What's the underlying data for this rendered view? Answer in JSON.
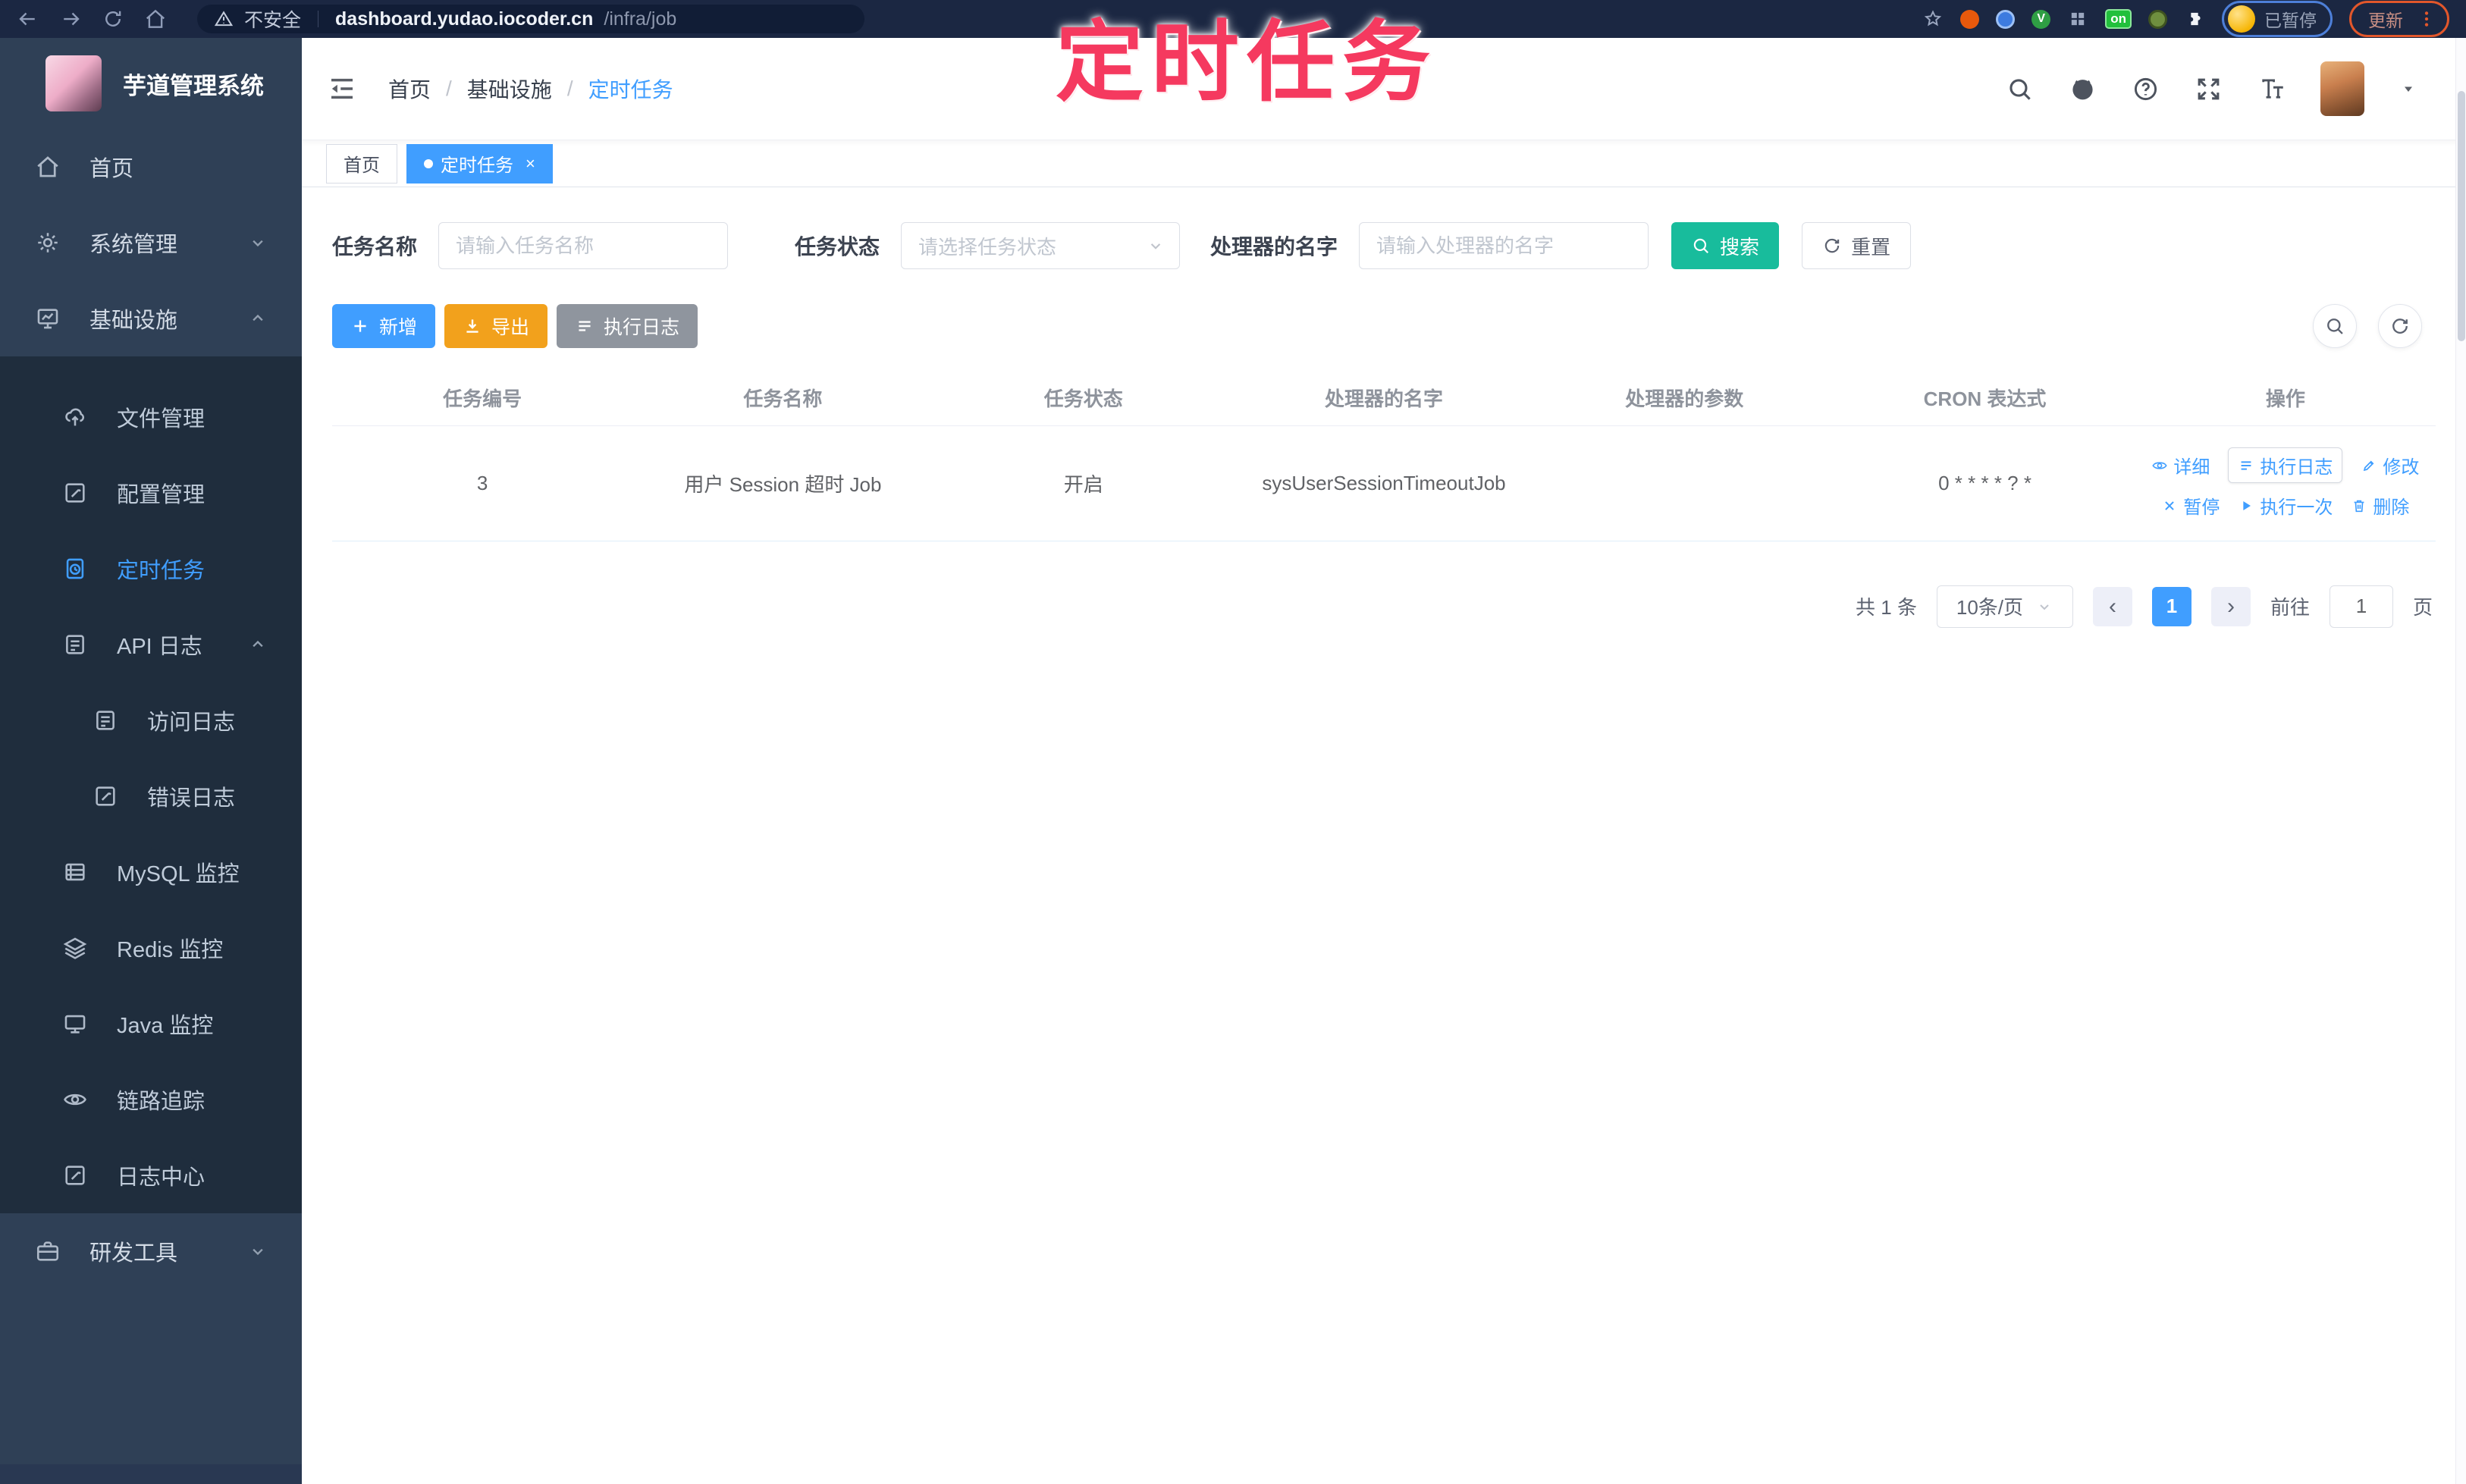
{
  "browser": {
    "security_label": "不安全",
    "url_host": "dashboard.yudao.iocoder.cn",
    "url_path": "/infra/job",
    "extension_on_badge": "on",
    "green_dot_glyph": "V",
    "profile_paused_label": "已暂停",
    "update_label": "更新"
  },
  "annotation": {
    "text": "定时任务"
  },
  "sidebar": {
    "title": "芋道管理系统",
    "items": [
      {
        "label": "首页"
      },
      {
        "label": "系统管理"
      },
      {
        "label": "基础设施"
      },
      {
        "label": "文件管理"
      },
      {
        "label": "配置管理"
      },
      {
        "label": "定时任务"
      },
      {
        "label": "API 日志"
      },
      {
        "label": "访问日志"
      },
      {
        "label": "错误日志"
      },
      {
        "label": "MySQL 监控"
      },
      {
        "label": "Redis 监控"
      },
      {
        "label": "Java 监控"
      },
      {
        "label": "链路追踪"
      },
      {
        "label": "日志中心"
      },
      {
        "label": "研发工具"
      }
    ]
  },
  "header": {
    "separator": "/",
    "breadcrumb": [
      "首页",
      "基础设施",
      "定时任务"
    ]
  },
  "tabs": {
    "home": "首页",
    "job": "定时任务",
    "close_glyph": "×"
  },
  "filters": {
    "name_label": "任务名称",
    "name_placeholder": "请输入任务名称",
    "status_label": "任务状态",
    "status_placeholder": "请选择任务状态",
    "handler_label": "处理器的名字",
    "handler_placeholder": "请输入处理器的名字",
    "search_label": "搜索",
    "reset_label": "重置"
  },
  "toolbar": {
    "add_label": "新增",
    "export_label": "导出",
    "log_label": "执行日志"
  },
  "table": {
    "headers": [
      "任务编号",
      "任务名称",
      "任务状态",
      "处理器的名字",
      "处理器的参数",
      "CRON 表达式",
      "操作"
    ],
    "row": {
      "id": "3",
      "name": "用户 Session 超时 Job",
      "status": "开启",
      "handler": "sysUserSessionTimeoutJob",
      "param": "",
      "cron": "0 * * * * ? *"
    },
    "actions": {
      "detail": "详细",
      "log": "执行日志",
      "edit": "修改",
      "pause": "暂停",
      "run_once": "执行一次",
      "delete": "删除"
    }
  },
  "pagination": {
    "total": "共 1 条",
    "page_size": "10条/页",
    "prev_glyph": "‹",
    "current_page": "1",
    "next_glyph": "›",
    "goto_label": "前往",
    "goto_value": "1",
    "page_unit": "页"
  },
  "colors": {
    "accent": "#409eff",
    "search_button": "#18bc9c",
    "export_button": "#f2a11c",
    "info_button": "#8f959e",
    "annotation": "#f5395f",
    "sidebar_bg": "#2f4056",
    "submenu_bg": "#1f2d3d"
  }
}
